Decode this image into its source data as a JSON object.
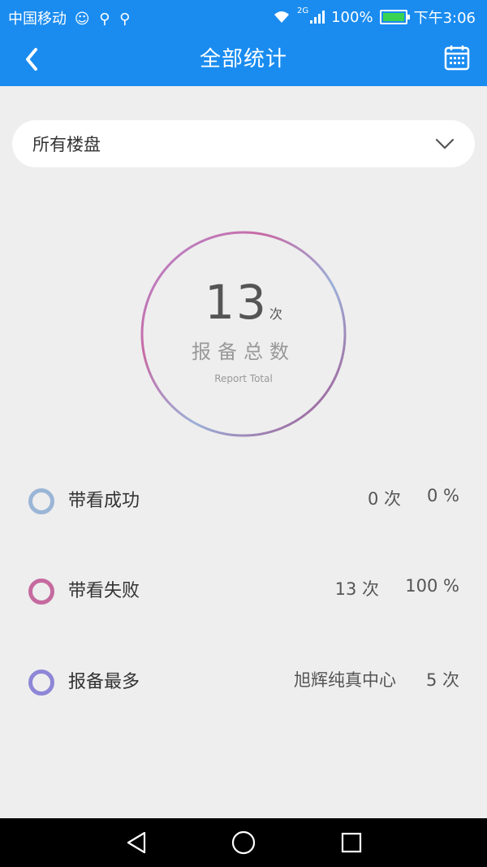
{
  "status_bar": {
    "carrier": "中国移动",
    "network": "2G",
    "battery": "100%",
    "time": "下午3:06",
    "battery_color": "#39d353"
  },
  "app_bar": {
    "title": "全部统计",
    "back_icon": "chevron-left-icon",
    "calendar_icon": "calendar-icon",
    "color": "#1a8cf0"
  },
  "selector": {
    "value": "所有楼盘",
    "icon": "chevron-down-icon"
  },
  "summary": {
    "count": "13",
    "unit": "次",
    "label": "报备总数",
    "label_en": "Report Total"
  },
  "stats": [
    {
      "name": "带看成功",
      "value1": "0 次",
      "value2": "0 %",
      "color": "#9ab5d6"
    },
    {
      "name": "带看失败",
      "value1": "13 次",
      "value2": "100 %",
      "color": "#c56a9f"
    },
    {
      "name": "报备最多",
      "value1": "旭辉纯真中心",
      "value2": "5 次",
      "color": "#8e86d6"
    }
  ],
  "nav": {
    "back_icon": "triangle-back-icon",
    "home_icon": "circle-home-icon",
    "recent_icon": "square-recent-icon"
  }
}
